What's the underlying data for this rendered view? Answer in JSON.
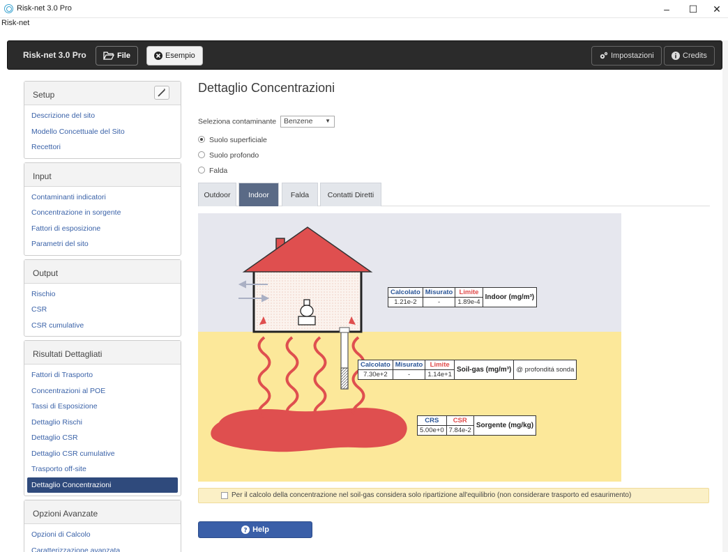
{
  "window": {
    "title": "Risk-net 3.0 Pro",
    "menu": "Risk-net",
    "minimize": "–",
    "maximize": "☐",
    "close": "✕"
  },
  "toolbar": {
    "brand": "Risk-net 3.0 Pro",
    "file_label": "File",
    "example_label": "Esempio",
    "settings_label": "Impostazioni",
    "credits_label": "Credits"
  },
  "sidebar": {
    "setup": {
      "title": "Setup",
      "items": [
        "Descrizione del sito",
        "Modello Concettuale del Sito",
        "Recettori"
      ]
    },
    "input": {
      "title": "Input",
      "items": [
        "Contaminanti indicatori",
        "Concentrazione in sorgente",
        "Fattori di esposizione",
        "Parametri del sito"
      ]
    },
    "output": {
      "title": "Output",
      "items": [
        "Rischio",
        "CSR",
        "CSR cumulative"
      ]
    },
    "results": {
      "title": "Risultati Dettagliati",
      "items": [
        "Fattori di Trasporto",
        "Concentrazioni al POE",
        "Tassi di Esposizione",
        "Dettaglio Rischi",
        "Dettaglio CSR",
        "Dettaglio CSR cumulative",
        "Trasporto off-site",
        "Dettaglio Concentrazioni"
      ],
      "active_index": 7
    },
    "advanced": {
      "title": "Opzioni Avanzate",
      "items": [
        "Opzioni di Calcolo",
        "Caratterizzazione avanzata"
      ]
    }
  },
  "main": {
    "title": "Dettaglio Concentrazioni",
    "select_label": "Seleziona contaminante",
    "select_value": "Benzene",
    "radios": [
      {
        "label": "Suolo superficiale",
        "checked": true
      },
      {
        "label": "Suolo profondo",
        "checked": false
      },
      {
        "label": "Falda",
        "checked": false
      }
    ],
    "tabs": [
      "Outdoor",
      "Indoor",
      "Falda",
      "Contatti Diretti"
    ],
    "active_tab": "Indoor",
    "indoor_table": {
      "h1": "Calcolato",
      "h2": "Misurato",
      "h3": "Limite",
      "v1": "1.21e-2",
      "v2": "-",
      "v3": "1.89e-4",
      "side": "Indoor (mg/m³)"
    },
    "soilgas_table": {
      "h1": "Calcolato",
      "h2": "Misurato",
      "h3": "Limite",
      "v1": "7.30e+2",
      "v2": "-",
      "v3": "1.14e+1",
      "side": "Soil-gas (mg/m³)",
      "extra": "@ profonditá sonda"
    },
    "source_table": {
      "h1": "CRS",
      "h2": "CSR",
      "v1": "5.00e+0",
      "v2": "7.84e-2",
      "side": "Sorgente (mg/kg)"
    },
    "notice": "Per il calcolo della concentrazione nel soil-gas considera solo ripartizione all'equilibrio (non considerare trasporto ed esaurimento)",
    "help_label": "Help"
  },
  "colors": {
    "sky": "#e6e7ee",
    "soil": "#fce89a",
    "house": "#e04a4a",
    "accent": "#3a5fa8",
    "nav_active": "#2f4a7c"
  }
}
